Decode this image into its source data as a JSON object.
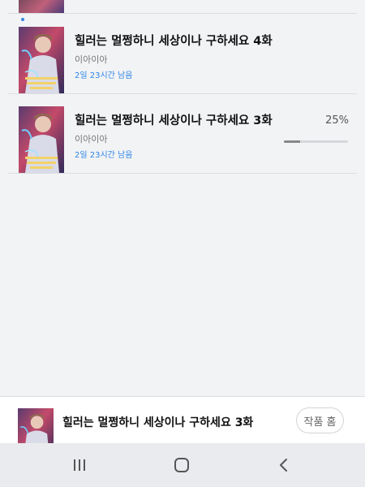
{
  "episodes": [
    {
      "title": "힐러는 멀쩡하니 세상이나 구하세요 4화",
      "author": "이아이아",
      "remaining": "2일 23시간 남음",
      "is_new": true
    },
    {
      "title": "힐러는 멀쩡하니 세상이나 구하세요 3화",
      "author": "이아이아",
      "remaining": "2일 23시간 남음",
      "progress_label": "25%",
      "progress": 0.25
    }
  ],
  "now_reading": {
    "title": "힐러는 멀쩡하니 세상이나 구하세요 3화",
    "home_button": "작품 홈"
  },
  "system_nav": {
    "icons": [
      "recent-apps-icon",
      "home-icon",
      "back-icon"
    ]
  },
  "colors": {
    "accent": "#2e86e8",
    "background": "#f2f3f5"
  }
}
